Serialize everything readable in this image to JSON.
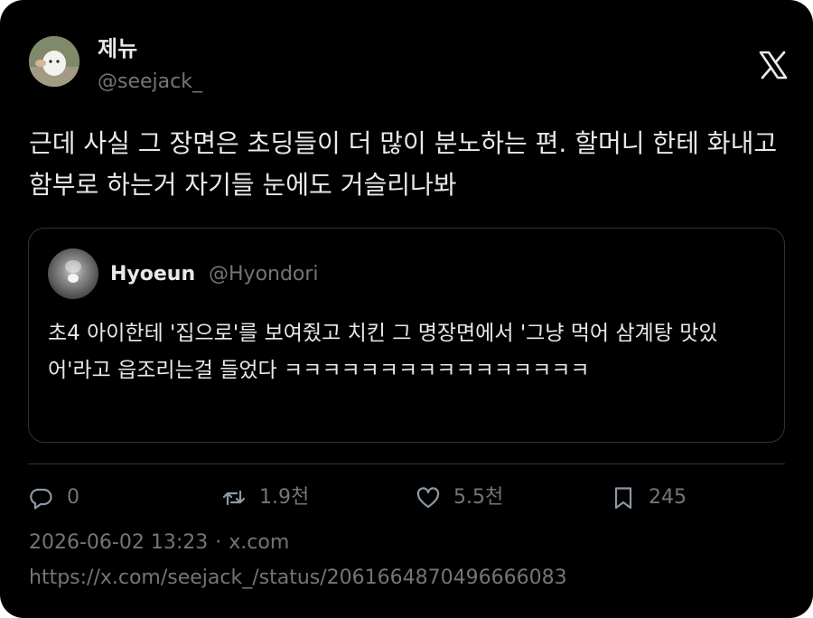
{
  "author": {
    "name": "제뉴",
    "handle": "@seejack_"
  },
  "brand_icon": "x-logo-icon",
  "tweet": {
    "text": "근데 사실 그 장면은 초딩들이 더 많이 분노하는 편. 할머니 한테 화내고 함부로 하는거 자기들 눈에도 거슬리나봐"
  },
  "quote": {
    "name": "Hyoeun",
    "handle": "@Hyondori",
    "text": "초4 아이한테 '집으로'를 보여줬고 치킨 그 명장면에서 '그냥 먹어 삼계탕 맛있어'라고 읍조리는걸 들었다 ㅋㅋㅋㅋㅋㅋㅋㅋㅋㅋㅋㅋㅋㅋㅋㅋ"
  },
  "actions": {
    "reply": {
      "icon": "reply-icon",
      "count": "0"
    },
    "retweet": {
      "icon": "retweet-icon",
      "count": "1.9천"
    },
    "like": {
      "icon": "heart-icon",
      "count": "5.5천"
    },
    "bookmark": {
      "icon": "bookmark-icon",
      "count": "245"
    }
  },
  "meta": {
    "timestamp": "2026-06-02 13:23",
    "separator": "·",
    "source": "x.com"
  },
  "url": "https://x.com/seejack_/status/2061664870496666083",
  "colors": {
    "background": "#000000",
    "text_primary": "#e7e9ea",
    "text_secondary": "#71767b",
    "border": "#2f3336"
  }
}
